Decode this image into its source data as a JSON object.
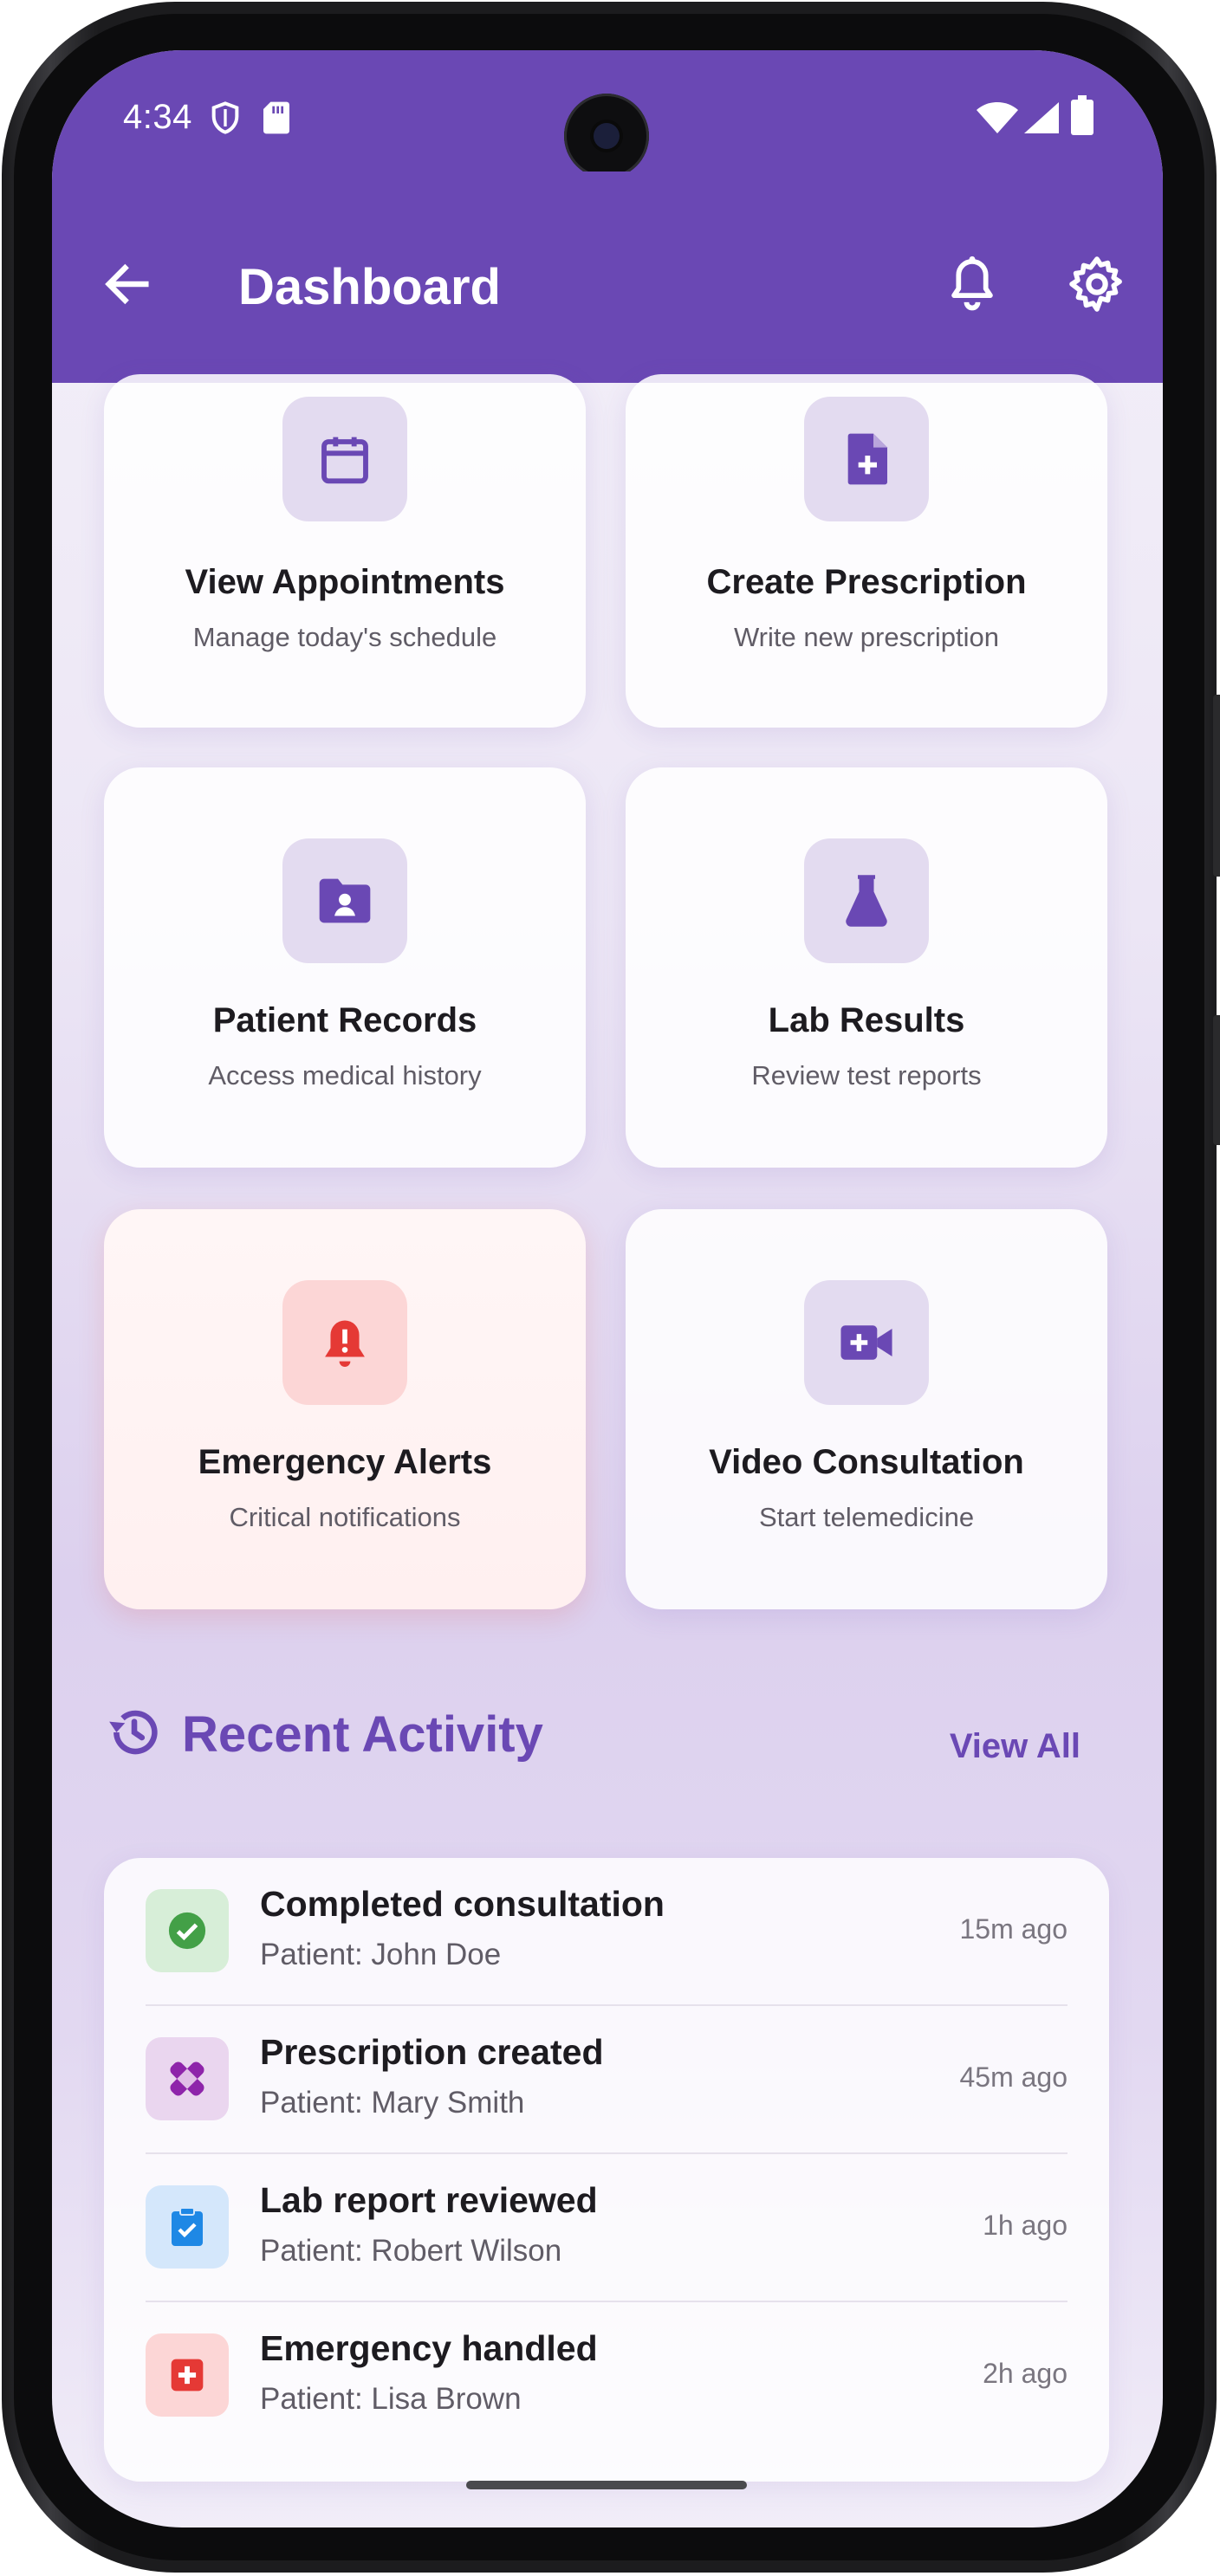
{
  "status_bar": {
    "time": "4:34"
  },
  "app_bar": {
    "title": "Dashboard"
  },
  "cards": [
    {
      "title": "View Appointments",
      "subtitle": "Manage today's schedule",
      "icon": "calendar-icon"
    },
    {
      "title": "Create Prescription",
      "subtitle": "Write new prescription",
      "icon": "document-plus-icon"
    },
    {
      "title": "Patient Records",
      "subtitle": "Access medical history",
      "icon": "patient-folder-icon"
    },
    {
      "title": "Lab Results",
      "subtitle": "Review test reports",
      "icon": "flask-icon"
    },
    {
      "title": "Emergency Alerts",
      "subtitle": "Critical notifications",
      "icon": "alert-bell-icon"
    },
    {
      "title": "Video Consultation",
      "subtitle": "Start telemedicine",
      "icon": "video-plus-icon"
    }
  ],
  "recent_activity": {
    "title": "Recent Activity",
    "view_all": "View All",
    "items": [
      {
        "title": "Completed consultation",
        "patient": "Patient: John Doe",
        "time": "15m ago",
        "icon": "check-circle-icon",
        "color": "#43a047"
      },
      {
        "title": "Prescription created",
        "patient": "Patient: Mary Smith",
        "time": "45m ago",
        "icon": "bandage-icon",
        "color": "#8e24aa"
      },
      {
        "title": "Lab report reviewed",
        "patient": "Patient: Robert Wilson",
        "time": "1h ago",
        "icon": "clipboard-check-icon",
        "color": "#1e88e5"
      },
      {
        "title": "Emergency handled",
        "patient": "Patient: Lisa Brown",
        "time": "2h ago",
        "icon": "medical-cross-icon",
        "color": "#e53935"
      }
    ]
  },
  "colors": {
    "primary": "#6a48b4",
    "tile": "#e3dbf0",
    "danger": "#e53935"
  }
}
